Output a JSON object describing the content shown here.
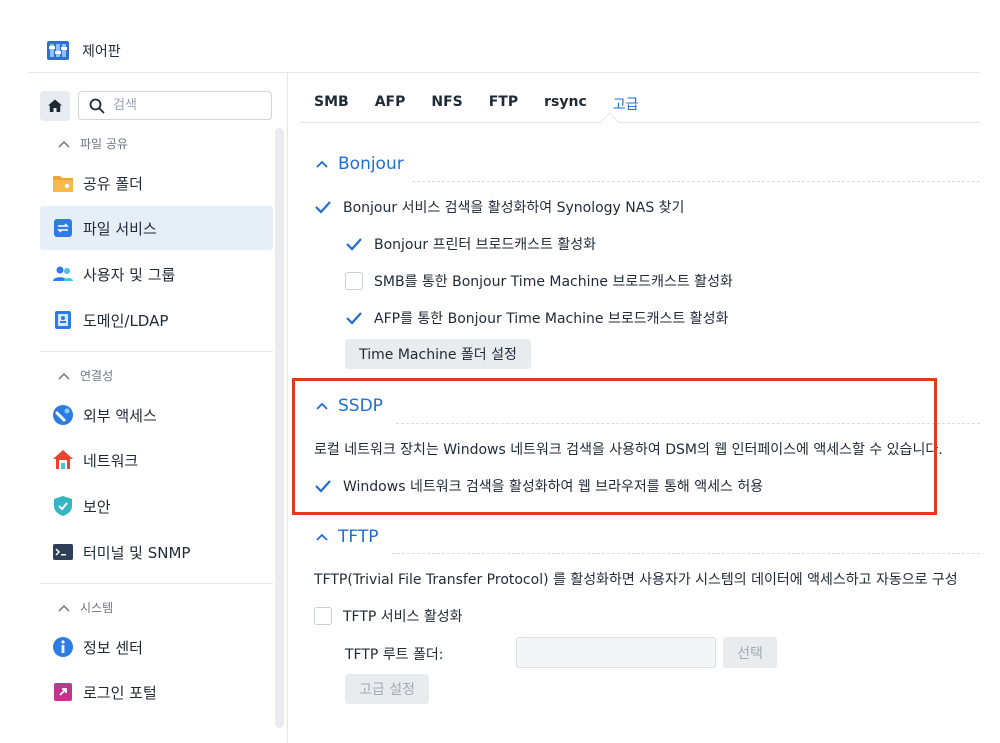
{
  "app": {
    "title": "제어판",
    "icon": "control-panel-icon"
  },
  "search": {
    "placeholder": "검색"
  },
  "sidebar": {
    "sections": [
      {
        "label": "파일 공유"
      },
      {
        "label": "연결성"
      },
      {
        "label": "시스템"
      }
    ],
    "items": [
      {
        "label": "공유 폴더",
        "icon": "shared-folder-icon"
      },
      {
        "label": "파일 서비스",
        "icon": "file-services-icon",
        "active": true
      },
      {
        "label": "사용자 및 그룹",
        "icon": "users-groups-icon"
      },
      {
        "label": "도메인/LDAP",
        "icon": "domain-ldap-icon"
      },
      {
        "label": "외부 액세스",
        "icon": "external-access-icon"
      },
      {
        "label": "네트워크",
        "icon": "network-icon"
      },
      {
        "label": "보안",
        "icon": "security-icon"
      },
      {
        "label": "터미널 및 SNMP",
        "icon": "terminal-icon"
      },
      {
        "label": "정보 센터",
        "icon": "info-center-icon"
      },
      {
        "label": "로그인 포털",
        "icon": "login-portal-icon"
      }
    ]
  },
  "tabs": [
    {
      "label": "SMB"
    },
    {
      "label": "AFP"
    },
    {
      "label": "NFS"
    },
    {
      "label": "FTP"
    },
    {
      "label": "rsync"
    },
    {
      "label": "고급",
      "active": true
    }
  ],
  "bonjour": {
    "title": "Bonjour",
    "options": [
      {
        "label": "Bonjour 서비스 검색을 활성화하여 Synology NAS 찾기",
        "checked": true
      },
      {
        "label": "Bonjour 프린터 브로드캐스트 활성화",
        "checked": true
      },
      {
        "label": "SMB를 통한 Bonjour Time Machine 브로드캐스트 활성화",
        "checked": false
      },
      {
        "label": "AFP를 통한 Bonjour Time Machine 브로드캐스트 활성화",
        "checked": true
      }
    ],
    "button": "Time Machine 폴더 설정"
  },
  "ssdp": {
    "title": "SSDP",
    "description": "로컬 네트워크 장치는 Windows 네트워크 검색을 사용하여 DSM의 웹 인터페이스에 액세스할 수 있습니다.",
    "option": {
      "label": "Windows 네트워크 검색을 활성화하여 웹 브라우저를 통해 액세스 허용",
      "checked": true
    }
  },
  "tftp": {
    "title": "TFTP",
    "description": "TFTP(Trivial File Transfer Protocol) 를 활성화하면 사용자가 시스템의 데이터에 액세스하고 자동으로 구성",
    "option": {
      "label": "TFTP 서비스 활성화",
      "checked": false
    },
    "root_label": "TFTP 루트 폴더:",
    "root_value": "",
    "select_button": "선택",
    "advanced_button": "고급 설정"
  },
  "colors": {
    "accent": "#1f6ed4",
    "highlight": "#e5381f",
    "active_bg": "#e6eef7"
  }
}
